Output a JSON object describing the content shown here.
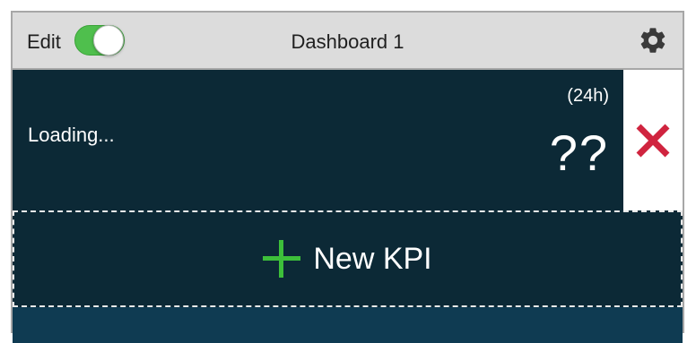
{
  "header": {
    "edit_label": "Edit",
    "edit_enabled": true,
    "title": "Dashboard 1",
    "settings_icon": "gear-icon"
  },
  "kpi_card": {
    "period": "(24h)",
    "status": "Loading...",
    "value": "??",
    "delete_icon": "close-icon"
  },
  "new_kpi": {
    "label": "New KPI",
    "icon": "plus-icon"
  },
  "colors": {
    "header_bg": "#dcdcdc",
    "card_bg": "#0c2936",
    "toggle_on": "#4fbf4d",
    "delete_red": "#d0243f",
    "plus_green": "#3dbf3a"
  }
}
